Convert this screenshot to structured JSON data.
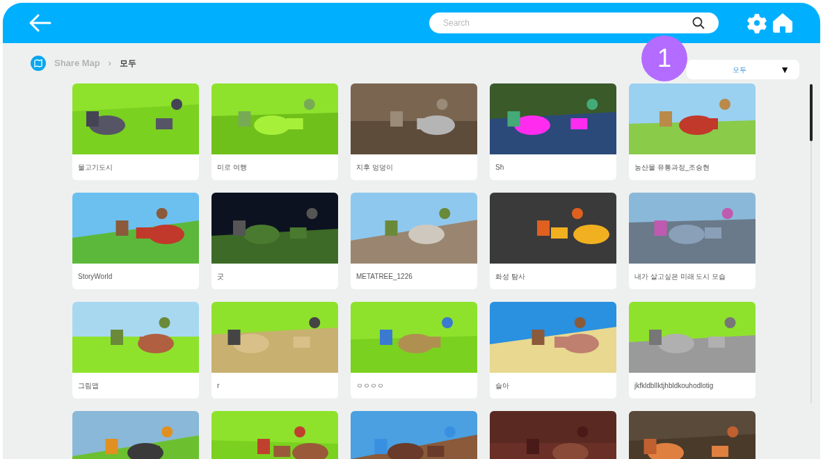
{
  "header": {
    "search": {
      "placeholder": "Search"
    }
  },
  "breadcrumb": {
    "items": [
      "Share Map",
      "모두"
    ],
    "separator": "›"
  },
  "filter": {
    "value": "모두",
    "caret": "▼"
  },
  "callout": {
    "label": "1"
  },
  "maps": [
    {
      "title": "물고기도시"
    },
    {
      "title": "미로 여행"
    },
    {
      "title": "지후 엉덩이"
    },
    {
      "title": "Sh"
    },
    {
      "title": "농산물 유통과정_조승현"
    },
    {
      "title": "StoryWorld"
    },
    {
      "title": "굿"
    },
    {
      "title": "METATREE_1226"
    },
    {
      "title": "화성 탐사"
    },
    {
      "title": "내가 살고싶은 미래 도시 모습"
    },
    {
      "title": "그림맵"
    },
    {
      "title": "r"
    },
    {
      "title": "ㅇㅇㅇㅇ"
    },
    {
      "title": "슬아"
    },
    {
      "title": "jkfkldblIktjhbldkouhodlotig"
    },
    {
      "kind": "picture"
    },
    {
      "kind": "picture"
    },
    {
      "kind": "picture"
    },
    {
      "kind": "picture"
    },
    {
      "kind": "picture"
    }
  ]
}
